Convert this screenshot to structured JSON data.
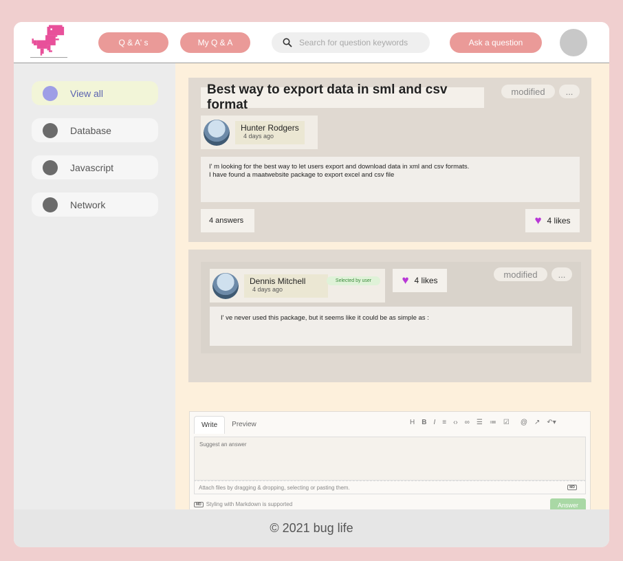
{
  "header": {
    "nav_qa": "Q & A' s",
    "nav_my_qa": "My Q & A",
    "search_placeholder": "Search for question keywords",
    "ask_button": "Ask a question"
  },
  "sidebar": {
    "items": [
      {
        "label": "View all"
      },
      {
        "label": "Database"
      },
      {
        "label": "Javascript"
      },
      {
        "label": "Network"
      }
    ]
  },
  "question": {
    "title": "Best way to export data in sml and csv format",
    "modified_label": "modified",
    "more_label": "...",
    "author": "Hunter Rodgers",
    "time": "4 days ago",
    "body_line1": "I' m looking for the best way to let users export and download data in xml and csv formats.",
    "body_line2": "I have found a maatwebsite package to export excel and csv file",
    "answers": "4 answers",
    "likes": "4 likes"
  },
  "answer": {
    "author": "Dennis Mitchell",
    "time": "4 days ago",
    "badge": "Selected by user",
    "likes": "4 likes",
    "modified_label": "modified",
    "more_label": "...",
    "body": "I' ve never used this package, but it seems like it could be as simple as :"
  },
  "editor": {
    "tab_write": "Write",
    "tab_preview": "Preview",
    "placeholder": "Suggest an answer",
    "attach_hint": "Attach files by dragging & dropping, selecting or pasting them.",
    "markdown_note": "Styling with Markdown is supported",
    "md_icon": "MD",
    "answer_button": "Answer"
  },
  "footer": {
    "copyright": "© 2021 bug life"
  }
}
